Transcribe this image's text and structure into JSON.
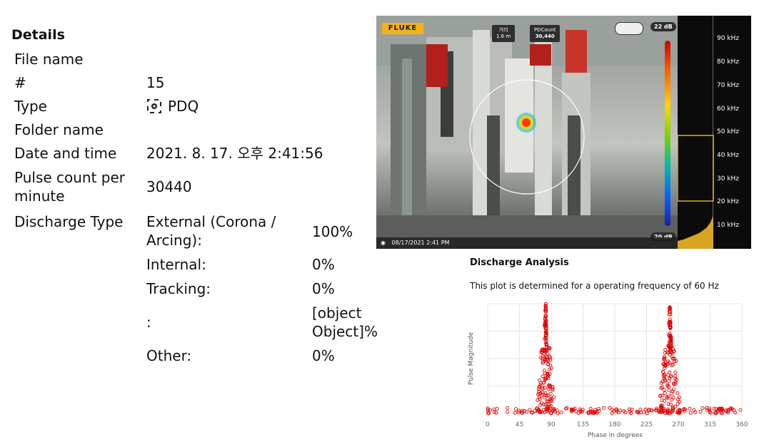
{
  "details": {
    "title": "Details",
    "rows": [
      {
        "label": "File name",
        "value": ""
      },
      {
        "label": "#",
        "value": "15"
      },
      {
        "label": "Type",
        "value": "PDQ",
        "icon": "pd-scan-icon"
      },
      {
        "label": "Folder name",
        "value": ""
      },
      {
        "label": "Date and time",
        "value": "2021. 8. 17. 오후 2:41:56"
      },
      {
        "label": "Pulse count per minute",
        "value": "30440"
      }
    ],
    "discharge_type_label": "Discharge Type",
    "discharge_types": [
      {
        "name": "External (Corona / Arcing):",
        "value": "100%"
      },
      {
        "name": "Internal:",
        "value": "0%"
      },
      {
        "name": "Tracking:",
        "value": "0%"
      },
      {
        "name": ":",
        "value": "[object Object]%"
      },
      {
        "name": "Other:",
        "value": "0%"
      }
    ]
  },
  "camera": {
    "brand": "FLUKE",
    "distance_label": "거리",
    "distance_value": "1.6 m",
    "pdcount_label": "PDCount",
    "pdcount_value": "30,440",
    "scale_max": "22 dB",
    "scale_min": "20 dB",
    "timestamp": "08/17/2021   2:41 PM",
    "freq_labels": [
      "90 kHz",
      "80 kHz",
      "70 kHz",
      "60 kHz",
      "50 kHz",
      "40 kHz",
      "30 kHz",
      "20 kHz",
      "10 kHz"
    ],
    "accent_color": "#f6b21b"
  },
  "analysis": {
    "title": "Discharge Analysis",
    "subtitle": "This plot is determined for a operating frequency of 60 Hz"
  },
  "chart_data": {
    "type": "scatter",
    "xlabel": "Phase in degrees",
    "ylabel": "Pulse Magnitude",
    "xlim": [
      0,
      360
    ],
    "x_ticks": [
      0,
      45,
      90,
      135,
      180,
      225,
      270,
      315,
      360
    ],
    "grid": true,
    "marker_color": "#e00000",
    "clusters": [
      {
        "x_range": [
          70,
          95
        ],
        "magnitude_range": [
          0.0,
          1.0
        ],
        "peak_x": 82
      },
      {
        "x_range": [
          245,
          275
        ],
        "magnitude_range": [
          0.0,
          1.0
        ],
        "peak_x": 258
      },
      {
        "x_range": [
          0,
          360
        ],
        "magnitude_range": [
          0.0,
          0.05
        ],
        "note": "baseline noise"
      }
    ]
  }
}
